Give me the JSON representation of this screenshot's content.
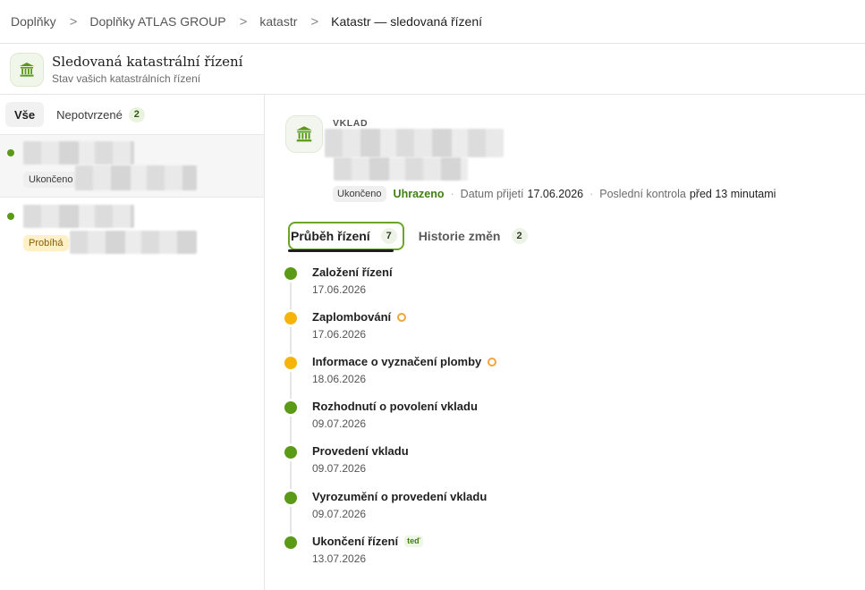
{
  "breadcrumb": [
    "Doplňky",
    "Doplňky ATLAS GROUP",
    "katastr",
    "Katastr — sledovaná řízení"
  ],
  "breadcrumb_separator": ">",
  "header": {
    "title": "Sledovaná katastrální řízení",
    "subtitle": "Stav vašich katastrálních řízení",
    "icon": "bank-icon"
  },
  "filters": {
    "all_label": "Vše",
    "unconfirmed_label": "Nepotvrzené",
    "unconfirmed_count": "2"
  },
  "list": [
    {
      "status": "Ukončeno",
      "status_color": "#5a9a16",
      "selected": true
    },
    {
      "status": "Probíhá",
      "status_color": "#5a9a16",
      "selected": false
    }
  ],
  "detail": {
    "type": "VKLAD",
    "status": "Ukončeno",
    "payment": "Uhrazeno",
    "received_label": "Datum přijetí",
    "received_value": "17.06.2026",
    "last_check_label": "Poslední kontrola",
    "last_check_value": "před 13 minutami"
  },
  "tabs": [
    {
      "label": "Průběh řízení",
      "count": "7",
      "active": true
    },
    {
      "label": "Historie změn",
      "count": "2",
      "active": false
    }
  ],
  "timeline": [
    {
      "title": "Založení řízení",
      "date": "17.06.2026",
      "state": "done",
      "marker": ""
    },
    {
      "title": "Zaplombování",
      "date": "17.06.2026",
      "state": "pending",
      "marker": "pending-icon"
    },
    {
      "title": "Informace o vyznačení plomby",
      "date": "18.06.2026",
      "state": "pending",
      "marker": "pending-icon"
    },
    {
      "title": "Rozhodnutí o povolení vkladu",
      "date": "09.07.2026",
      "state": "done",
      "marker": ""
    },
    {
      "title": "Provedení vkladu",
      "date": "09.07.2026",
      "state": "done",
      "marker": ""
    },
    {
      "title": "Vyrozumění o provedení vkladu",
      "date": "09.07.2026",
      "state": "done",
      "marker": ""
    },
    {
      "title": "Ukončení řízení",
      "date": "13.07.2026",
      "state": "done",
      "marker": "teď"
    }
  ],
  "colors": {
    "accent": "#5a9a16",
    "pending": "#f6b40b",
    "paid": "#3f7e12"
  }
}
